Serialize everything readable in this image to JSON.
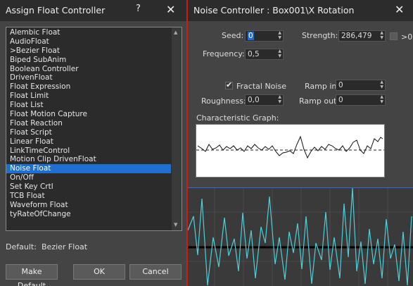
{
  "assign": {
    "title": "Assign Float Controller",
    "help": "?",
    "close": "✕",
    "items": [
      "Alembic Float",
      "AudioFloat",
      ">Bezier Float",
      "Biped SubAnim",
      "Boolean Controller",
      "DrivenFloat",
      "Float Expression",
      "Float Limit",
      "Float List",
      "Float Motion Capture",
      "Float Reaction",
      "Float Script",
      "Linear Float",
      "LinkTimeControl",
      "Motion Clip DrivenFloat",
      "Noise Float",
      "On/Off",
      "Set Key Crtl",
      "TCB Float",
      "Waveform Float",
      "tyRateOfChange"
    ],
    "selected_index": 15,
    "default_label": "Default:",
    "default_value": "Bezier Float",
    "buttons": {
      "make_default": "Make Default",
      "ok": "OK",
      "cancel": "Cancel"
    }
  },
  "noise": {
    "title": "Noise Controller : Box001\\X Rotation",
    "close": "✕",
    "seed_label": "Seed:",
    "seed_value": "0",
    "strength_label": "Strength:",
    "strength_value": "286,479",
    "gt0_label": ">0",
    "gt0_checked": false,
    "frequency_label": "Frequency:",
    "frequency_value": "0,5",
    "fractal_label": "Fractal Noise",
    "fractal_checked": true,
    "roughness_label": "Roughness:",
    "roughness_value": "0,0",
    "ramp_in_label": "Ramp in:",
    "ramp_in_value": "0",
    "ramp_out_label": "Ramp out:",
    "ramp_out_value": "0",
    "graph_label": "Characteristic Graph:"
  },
  "colors": {
    "selection": "#1f6fd0",
    "curve": "#4ed0d8",
    "separator": "#d01a1a"
  },
  "icons": [
    "help-icon",
    "close-icon",
    "spinner-arrows-icon",
    "checkmark-icon"
  ]
}
